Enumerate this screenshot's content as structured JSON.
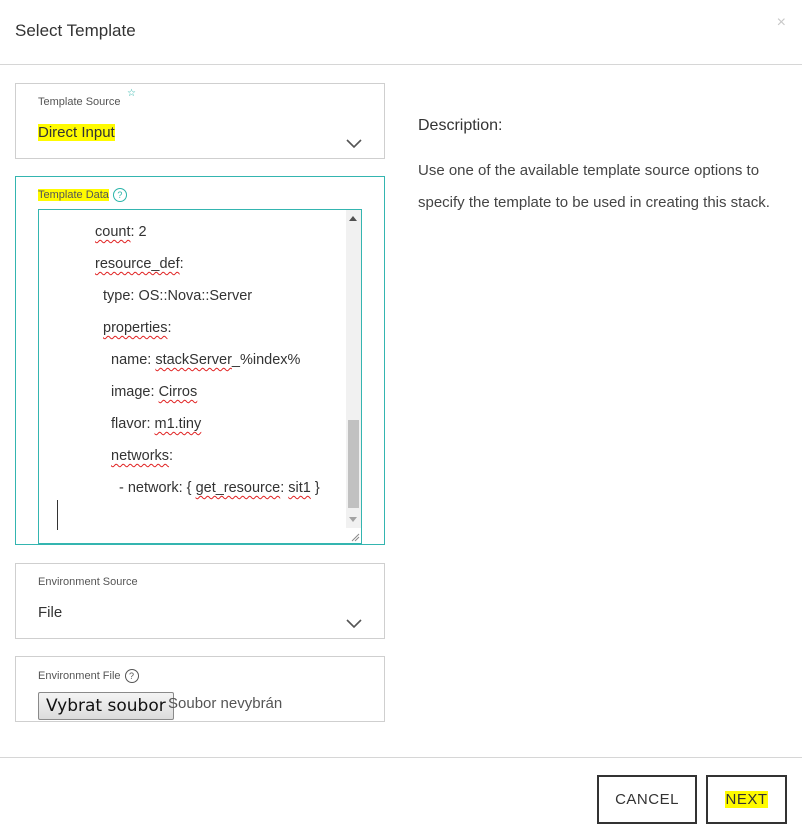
{
  "dialog": {
    "title": "Select Template",
    "close_symbol": "×"
  },
  "template_source": {
    "label": "Template Source",
    "required_mark": "☆",
    "value": "Direct Input",
    "chevron_icon": "chevron-down-icon"
  },
  "template_data": {
    "label": "Template Data",
    "help_symbol": "?",
    "lines": [
      {
        "indent": "",
        "key": "count",
        "rest": ": 2"
      },
      {
        "indent": "",
        "key": "resource_def",
        "rest": ":"
      },
      {
        "indent": "  ",
        "key": "",
        "rest": "type: OS::Nova::Server"
      },
      {
        "indent": "  ",
        "key": "properties",
        "rest": ":"
      },
      {
        "indent": "    ",
        "key": "",
        "rest": "name: ",
        "sq": "stackServer",
        "tail": "_%index%"
      },
      {
        "indent": "    ",
        "key": "",
        "rest": "image: ",
        "sq": "Cirros",
        "tail": ""
      },
      {
        "indent": "    ",
        "key": "",
        "rest": "flavor: ",
        "sq": "m1.tiny",
        "tail": ""
      },
      {
        "indent": "    ",
        "key": "networks",
        "rest": ":"
      },
      {
        "indent": "      ",
        "key": "",
        "rest": "- network: { ",
        "sq": "get_resource",
        "tail": ": ",
        "sq2": "sit1",
        "tail2": " }"
      }
    ]
  },
  "environment_source": {
    "label": "Environment Source",
    "value": "File",
    "chevron_icon": "chevron-down-icon"
  },
  "environment_file": {
    "label": "Environment File",
    "help_symbol": "?",
    "button_label": "Vybrat soubor",
    "status": "Soubor nevybrán"
  },
  "description": {
    "title": "Description:",
    "text": "Use one of the available template source options to specify the template to be used in creating this stack."
  },
  "footer": {
    "cancel_label": "CANCEL",
    "next_label": "NEXT"
  },
  "colors": {
    "accent": "#34b5b0",
    "highlight": "#fffb00",
    "border": "#cfcfcf",
    "text": "#333333"
  }
}
